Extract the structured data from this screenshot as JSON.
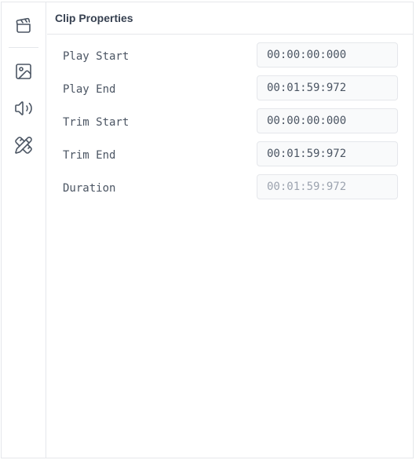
{
  "sidebar": {
    "items": [
      {
        "icon": "clapperboard-icon"
      },
      {
        "icon": "image-icon"
      },
      {
        "icon": "speaker-icon"
      },
      {
        "icon": "pencil-ruler-icon"
      }
    ]
  },
  "panel": {
    "title": "Clip Properties",
    "properties": [
      {
        "label": "Play Start",
        "value": "00:00:00:000"
      },
      {
        "label": "Play End",
        "value": "00:01:59:972"
      },
      {
        "label": "Trim Start",
        "value": "00:00:00:000"
      },
      {
        "label": "Trim End",
        "value": "00:01:59:972"
      },
      {
        "label": "Duration",
        "value": "00:01:59:972",
        "disabled": true
      }
    ]
  }
}
